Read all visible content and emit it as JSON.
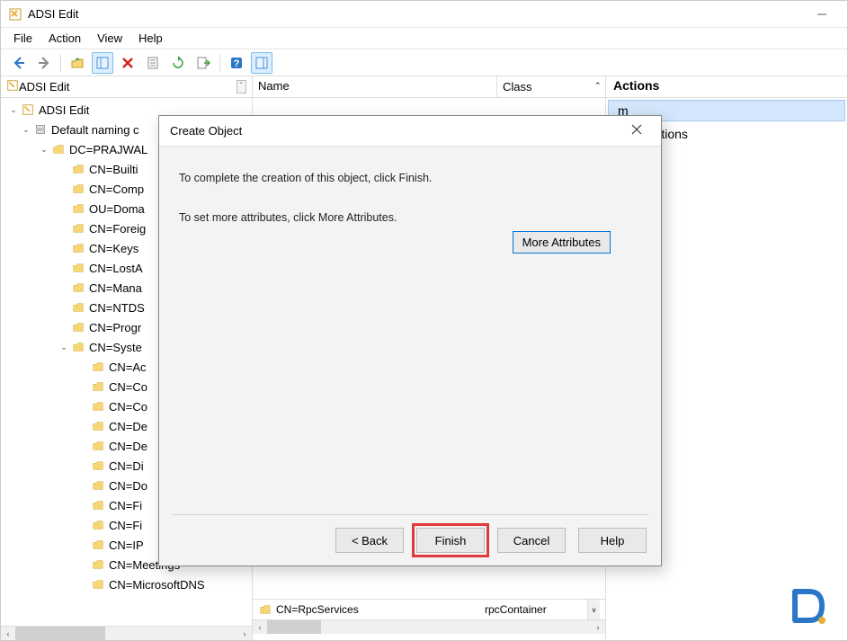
{
  "window": {
    "title": "ADSI Edit",
    "minimize": "−"
  },
  "menu": {
    "file": "File",
    "action": "Action",
    "view": "View",
    "help": "Help"
  },
  "tree": {
    "header": "ADSI Edit",
    "items": [
      {
        "indent": 0,
        "expander": "expanded",
        "icon": "app",
        "label": "ADSI Edit"
      },
      {
        "indent": 1,
        "expander": "expanded",
        "icon": "server",
        "label": "Default naming c"
      },
      {
        "indent": 2,
        "expander": "expanded",
        "icon": "folder",
        "label": "DC=PRAJWAL"
      },
      {
        "indent": 3,
        "expander": "none",
        "icon": "folder",
        "label": "CN=Builti"
      },
      {
        "indent": 3,
        "expander": "none",
        "icon": "folder",
        "label": "CN=Comp"
      },
      {
        "indent": 3,
        "expander": "none",
        "icon": "folder",
        "label": "OU=Doma"
      },
      {
        "indent": 3,
        "expander": "none",
        "icon": "folder",
        "label": "CN=Foreig"
      },
      {
        "indent": 3,
        "expander": "none",
        "icon": "folder",
        "label": "CN=Keys"
      },
      {
        "indent": 3,
        "expander": "none",
        "icon": "folder",
        "label": "CN=LostA"
      },
      {
        "indent": 3,
        "expander": "none",
        "icon": "folder",
        "label": "CN=Mana"
      },
      {
        "indent": 3,
        "expander": "none",
        "icon": "folder",
        "label": "CN=NTDS"
      },
      {
        "indent": 3,
        "expander": "none",
        "icon": "folder",
        "label": "CN=Progr"
      },
      {
        "indent": 3,
        "expander": "expanded",
        "icon": "folder",
        "label": "CN=Syste"
      },
      {
        "indent": 4,
        "expander": "none",
        "icon": "folder",
        "label": "CN=Ac"
      },
      {
        "indent": 4,
        "expander": "none",
        "icon": "folder",
        "label": "CN=Co"
      },
      {
        "indent": 4,
        "expander": "none",
        "icon": "folder",
        "label": "CN=Co"
      },
      {
        "indent": 4,
        "expander": "none",
        "icon": "folder",
        "label": "CN=De"
      },
      {
        "indent": 4,
        "expander": "none",
        "icon": "folder",
        "label": "CN=De"
      },
      {
        "indent": 4,
        "expander": "none",
        "icon": "folder",
        "label": "CN=Di"
      },
      {
        "indent": 4,
        "expander": "none",
        "icon": "folder",
        "label": "CN=Do"
      },
      {
        "indent": 4,
        "expander": "none",
        "icon": "folder",
        "label": "CN=Fi"
      },
      {
        "indent": 4,
        "expander": "none",
        "icon": "folder",
        "label": "CN=Fi"
      },
      {
        "indent": 4,
        "expander": "none",
        "icon": "folder",
        "label": "CN=IP"
      },
      {
        "indent": 4,
        "expander": "none",
        "icon": "folder",
        "label": "CN=Meetings"
      },
      {
        "indent": 4,
        "expander": "none",
        "icon": "folder",
        "label": "CN=MicrosoftDNS"
      }
    ]
  },
  "content": {
    "col_name": "Name",
    "col_class": "Class",
    "row_name": "CN=RpcServices",
    "row_class": "rpcContainer"
  },
  "actions": {
    "header": "Actions",
    "selected_suffix": "m",
    "more": "More Actions"
  },
  "modal": {
    "title": "Create Object",
    "text1": "To complete the creation of this object, click Finish.",
    "text2": "To set more attributes, click More Attributes.",
    "more_btn": "More Attributes",
    "back": "< Back",
    "finish": "Finish",
    "cancel": "Cancel",
    "help": "Help"
  }
}
